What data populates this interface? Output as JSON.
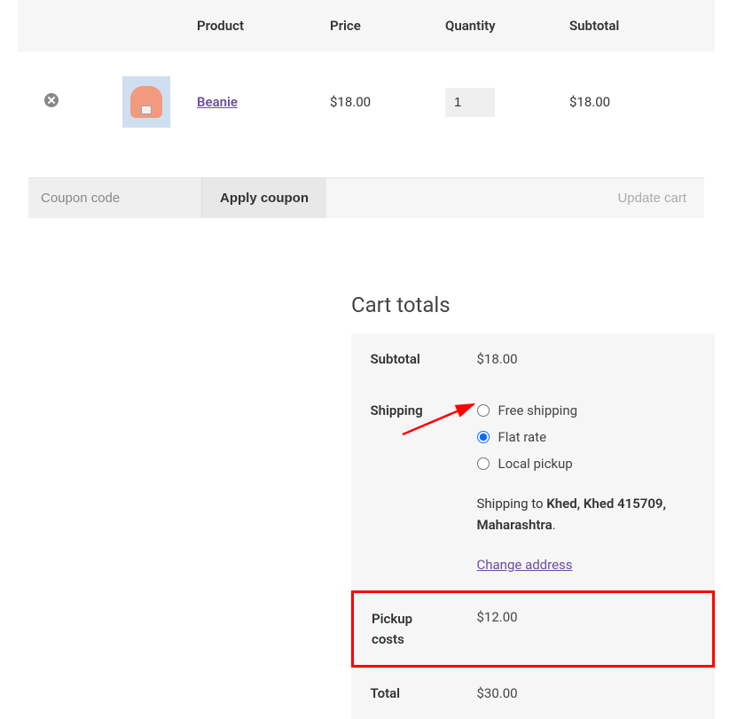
{
  "cart": {
    "headers": {
      "product": "Product",
      "price": "Price",
      "quantity": "Quantity",
      "subtotal": "Subtotal"
    },
    "items": [
      {
        "name": "Beanie",
        "price": "$18.00",
        "quantity": "1",
        "subtotal": "$18.00"
      }
    ],
    "coupon_placeholder": "Coupon code",
    "apply_coupon_label": "Apply coupon",
    "update_cart_label": "Update cart"
  },
  "totals": {
    "title": "Cart totals",
    "subtotal_label": "Subtotal",
    "subtotal_value": "$18.00",
    "shipping_label": "Shipping",
    "shipping_options": {
      "free": "Free shipping",
      "flat": "Flat rate",
      "local": "Local pickup"
    },
    "selected_shipping": "flat",
    "shipping_to_prefix": "Shipping to ",
    "shipping_to_dest": "Khed, Khed 415709, Maharashtra",
    "change_address_label": "Change address",
    "pickup_label": "Pickup costs",
    "pickup_value": "$12.00",
    "total_label": "Total",
    "total_value": "$30.00"
  }
}
